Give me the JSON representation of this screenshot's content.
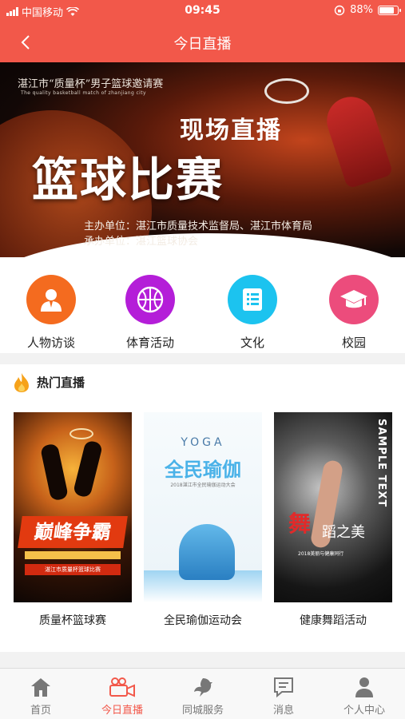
{
  "status_bar": {
    "carrier": "中国移动",
    "time": "09:45",
    "battery": "88%",
    "battery_level": 0.88
  },
  "nav": {
    "title": "今日直播"
  },
  "banner": {
    "event_line": "湛江市“质量杯”男子篮球邀请赛",
    "event_line_en": "The quality basketball match of zhanjiang city",
    "headline_small": "现场直播",
    "headline_big": "篮球比赛",
    "organizer": "主办单位：湛江市质量技术监督局、湛江市体育局",
    "co_organizer": "承办单位：湛江篮球协会"
  },
  "categories": [
    {
      "label": "人物访谈",
      "icon": "person-icon",
      "color": "#f46b1f"
    },
    {
      "label": "体育活动",
      "icon": "basketball-icon",
      "color": "#b41ed8"
    },
    {
      "label": "文化",
      "icon": "list-icon",
      "color": "#1cc3ef"
    },
    {
      "label": "校园",
      "icon": "graduation-cap-icon",
      "color": "#ec4c7c"
    }
  ],
  "hot": {
    "title": "热门直播",
    "icon": "flame-icon"
  },
  "posters": [
    {
      "caption": "质量杯篮球赛",
      "poster_title": "巅峰争霸",
      "poster_text": "湛江市质量杯篮球比赛"
    },
    {
      "caption": "全民瑜伽运动会",
      "poster_title": "全民瑜伽",
      "poster_yoga": "YOGA",
      "poster_text": "2018湛江市全民瑜伽运动大会"
    },
    {
      "caption": "健康舞蹈活动",
      "poster_side": "SAMPLE TEXT",
      "poster_wu": "舞",
      "poster_dao": "蹈之美",
      "poster_text": "2018美丽与健康同行"
    }
  ],
  "tabs": [
    {
      "label": "首页",
      "icon": "home-icon",
      "active": false
    },
    {
      "label": "今日直播",
      "icon": "video-camera-icon",
      "active": true
    },
    {
      "label": "同城服务",
      "icon": "dove-icon",
      "active": false
    },
    {
      "label": "消息",
      "icon": "message-icon",
      "active": false
    },
    {
      "label": "个人中心",
      "icon": "user-icon",
      "active": false
    }
  ],
  "colors": {
    "primary": "#f2584a",
    "tab_inactive": "#777777"
  }
}
